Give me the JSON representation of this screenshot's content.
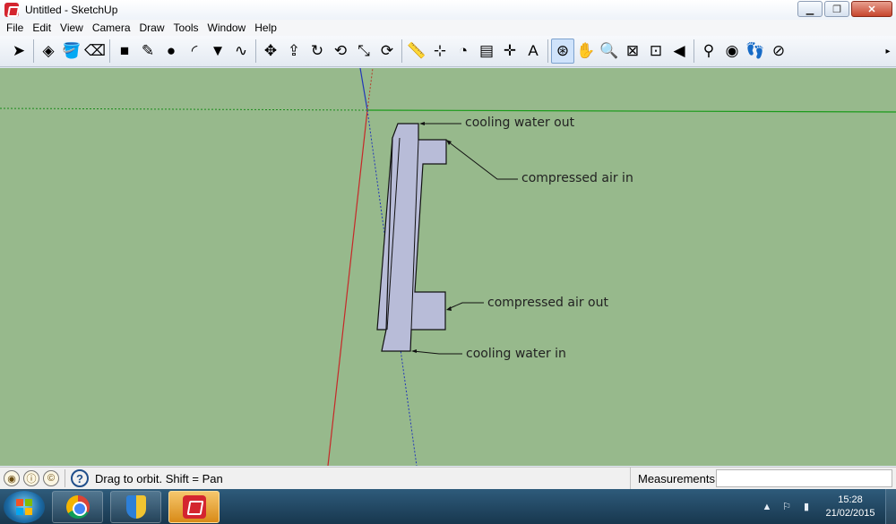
{
  "window": {
    "title": "Untitled - SketchUp",
    "controls": [
      "minimize-icon",
      "restore-icon",
      "close-icon"
    ]
  },
  "menu": [
    "File",
    "Edit",
    "View",
    "Camera",
    "Draw",
    "Tools",
    "Window",
    "Help"
  ],
  "toolbar": {
    "tools": [
      {
        "name": "select-icon",
        "glyph": "➤"
      },
      {
        "name": "make-component-icon",
        "glyph": "◈"
      },
      {
        "name": "paint-bucket-icon",
        "glyph": "🪣"
      },
      {
        "name": "eraser-icon",
        "glyph": "⌫"
      },
      {
        "name": "rectangle-icon",
        "glyph": "■"
      },
      {
        "name": "line-pencil-icon",
        "glyph": "✎"
      },
      {
        "name": "circle-icon",
        "glyph": "●"
      },
      {
        "name": "arc-icon",
        "glyph": "◜"
      },
      {
        "name": "polygon-icon",
        "glyph": "▼"
      },
      {
        "name": "freehand-icon",
        "glyph": "∿"
      },
      {
        "name": "move-icon",
        "glyph": "✥"
      },
      {
        "name": "push-pull-icon",
        "glyph": "⇪"
      },
      {
        "name": "rotate-icon",
        "glyph": "↻"
      },
      {
        "name": "follow-me-icon",
        "glyph": "⟲"
      },
      {
        "name": "scale-icon",
        "glyph": "⤡"
      },
      {
        "name": "offset-icon",
        "glyph": "⟳"
      },
      {
        "name": "tape-measure-icon",
        "glyph": "📏"
      },
      {
        "name": "dimension-icon",
        "glyph": "⊹"
      },
      {
        "name": "protractor-icon",
        "glyph": "◔"
      },
      {
        "name": "text-icon",
        "glyph": "▤"
      },
      {
        "name": "axes-icon",
        "glyph": "✛"
      },
      {
        "name": "3d-text-icon",
        "glyph": "A"
      },
      {
        "name": "orbit-icon",
        "glyph": "⊛"
      },
      {
        "name": "pan-icon",
        "glyph": "✋"
      },
      {
        "name": "zoom-icon",
        "glyph": "🔍"
      },
      {
        "name": "zoom-window-icon",
        "glyph": "⊠"
      },
      {
        "name": "zoom-extents-icon",
        "glyph": "⊡"
      },
      {
        "name": "previous-view-icon",
        "glyph": "◀"
      },
      {
        "name": "position-camera-icon",
        "glyph": "⚲"
      },
      {
        "name": "look-around-icon",
        "glyph": "◉"
      },
      {
        "name": "walk-icon",
        "glyph": "👣"
      },
      {
        "name": "section-plane-icon",
        "glyph": "⊘"
      }
    ],
    "more_glyph": "▸"
  },
  "viewport": {
    "background": "#97b98c",
    "face_color": "#b8bcd8",
    "labels": {
      "cooling_water_out": "cooling water out",
      "compressed_air_in": "compressed air in",
      "compressed_air_out": "compressed air out",
      "cooling_water_in": "cooling water in"
    }
  },
  "statusbar": {
    "icons": [
      "geo-location-icon",
      "credits-icon",
      "copyright-icon"
    ],
    "help_glyph": "?",
    "message": "Drag to orbit.  Shift = Pan",
    "measurements_label": "Measurements",
    "measurements_value": ""
  },
  "taskbar": {
    "apps": [
      "chrome-icon",
      "shield-app-icon",
      "sketchup-icon"
    ],
    "time": "15:28",
    "date": "21/02/2015"
  }
}
